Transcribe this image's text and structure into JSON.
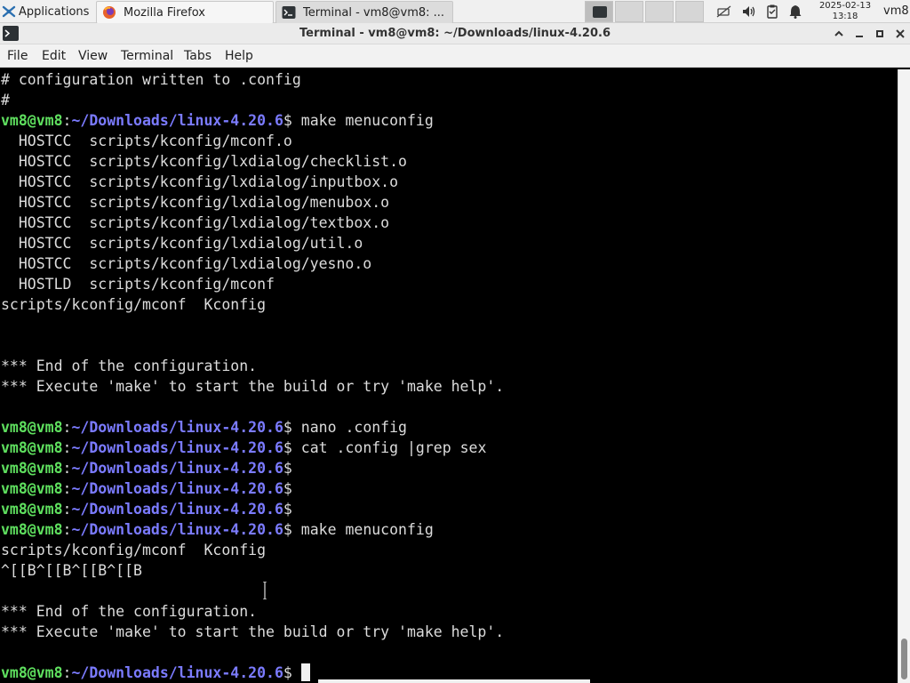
{
  "panel": {
    "apps_label": "Applications",
    "tasks": [
      {
        "label": "Mozilla Firefox",
        "icon": "firefox-icon"
      },
      {
        "label": "Terminal - vm8@vm8: ...",
        "icon": "terminal-icon"
      }
    ],
    "clock_date": "2025-02-13",
    "clock_time": "13:18",
    "user": "vm8"
  },
  "window": {
    "title": "Terminal - vm8@vm8: ~/Downloads/linux-4.20.6"
  },
  "menubar": {
    "items": [
      "File",
      "Edit",
      "View",
      "Terminal",
      "Tabs",
      "Help"
    ]
  },
  "prompt": {
    "user_host": "vm8@vm8",
    "sep": ":",
    "path": "~/Downloads/linux-4.20.6",
    "dollar": "$"
  },
  "terminal_lines": [
    {
      "text": "# configuration written to .config"
    },
    {
      "text": "#"
    },
    {
      "cmd": " make menuconfig"
    },
    {
      "text": "  HOSTCC  scripts/kconfig/mconf.o"
    },
    {
      "text": "  HOSTCC  scripts/kconfig/lxdialog/checklist.o"
    },
    {
      "text": "  HOSTCC  scripts/kconfig/lxdialog/inputbox.o"
    },
    {
      "text": "  HOSTCC  scripts/kconfig/lxdialog/menubox.o"
    },
    {
      "text": "  HOSTCC  scripts/kconfig/lxdialog/textbox.o"
    },
    {
      "text": "  HOSTCC  scripts/kconfig/lxdialog/util.o"
    },
    {
      "text": "  HOSTCC  scripts/kconfig/lxdialog/yesno.o"
    },
    {
      "text": "  HOSTLD  scripts/kconfig/mconf"
    },
    {
      "text": "scripts/kconfig/mconf  Kconfig"
    },
    {
      "text": ""
    },
    {
      "text": ""
    },
    {
      "text": "*** End of the configuration."
    },
    {
      "text": "*** Execute 'make' to start the build or try 'make help'."
    },
    {
      "text": ""
    },
    {
      "cmd": " nano .config"
    },
    {
      "cmd": " cat .config |grep sex"
    },
    {
      "cmd": ""
    },
    {
      "cmd": ""
    },
    {
      "cmd": ""
    },
    {
      "cmd": " make menuconfig"
    },
    {
      "text": "scripts/kconfig/mconf  Kconfig"
    },
    {
      "text": "^[[B^[[B^[[B^[[B"
    },
    {
      "text": ""
    },
    {
      "text": "*** End of the configuration."
    },
    {
      "text": "*** Execute 'make' to start the build or try 'make help'."
    },
    {
      "text": ""
    },
    {
      "cmd": " ",
      "cursor": true
    }
  ]
}
